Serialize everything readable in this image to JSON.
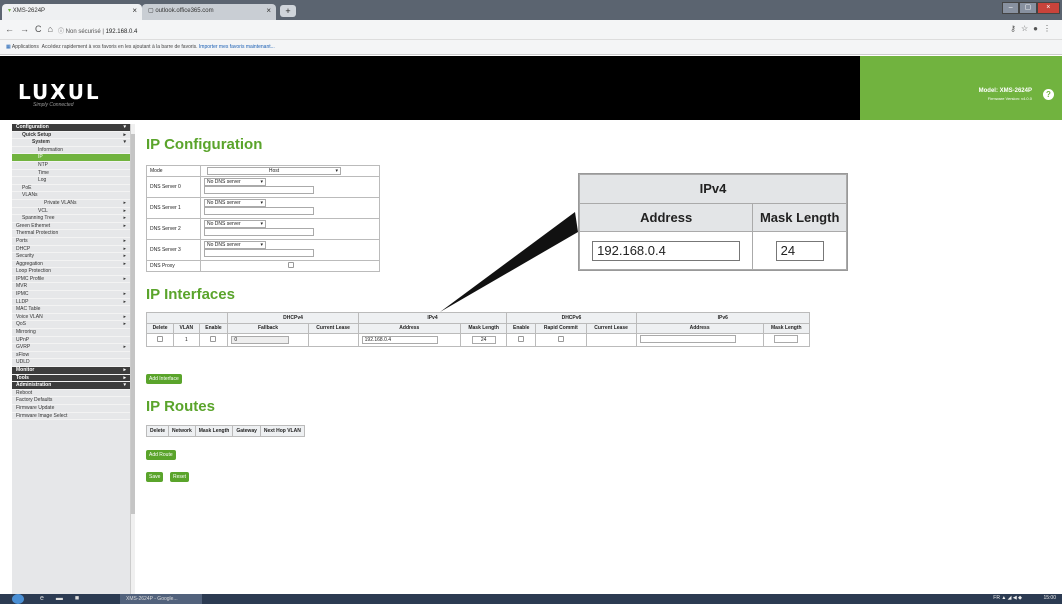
{
  "browser": {
    "tabs": [
      {
        "title": "XMS-2624P",
        "active": true
      },
      {
        "title": "outlook.office365.com",
        "active": false
      }
    ],
    "address": {
      "prefix": "Non sécurisé",
      "url": "192.168.0.4"
    },
    "bookmarks": {
      "apps": "Applications",
      "text": "Accédez rapidement à vos favoris en les ajoutant à la barre de favoris.",
      "link": "Importer mes favoris maintenant..."
    }
  },
  "header": {
    "logo": "LUXUL",
    "tagline": "Simply Connected",
    "model": "Model: XMS-2624P",
    "firmware": "Firmware Version: v4.0.0",
    "help": "?"
  },
  "sidebar": {
    "items": [
      {
        "label": "Configuration",
        "kind": "sec",
        "arrow": "▾"
      },
      {
        "label": "Quick Setup",
        "kind": "l1",
        "arrow": "▸"
      },
      {
        "label": "System",
        "kind": "l2",
        "arrow": "▾"
      },
      {
        "label": "Information",
        "kind": "l3"
      },
      {
        "label": "IP",
        "kind": "l3 active"
      },
      {
        "label": "NTP",
        "kind": "l3"
      },
      {
        "label": "Time",
        "kind": "l3"
      },
      {
        "label": "Log",
        "kind": "l3"
      },
      {
        "label": "PoE",
        "kind": "l1x"
      },
      {
        "label": "VLANs",
        "kind": "l1x"
      },
      {
        "label": "Private VLANs",
        "kind": "l4",
        "arrow": "▸"
      },
      {
        "label": "VCL",
        "kind": "l3",
        "arrow": "▸"
      },
      {
        "label": "Spanning Tree",
        "kind": "l1x",
        "arrow": "▸"
      },
      {
        "label": "Green Ethernet",
        "kind": "n",
        "arrow": "▸"
      },
      {
        "label": "Thermal Protection",
        "kind": "n"
      },
      {
        "label": "Ports",
        "kind": "n",
        "arrow": "▸"
      },
      {
        "label": "DHCP",
        "kind": "n",
        "arrow": "▸"
      },
      {
        "label": "Security",
        "kind": "n",
        "arrow": "▸"
      },
      {
        "label": "Aggregation",
        "kind": "n",
        "arrow": "▸"
      },
      {
        "label": "Loop Protection",
        "kind": "n"
      },
      {
        "label": "IPMC Profile",
        "kind": "n",
        "arrow": "▸"
      },
      {
        "label": "MVR",
        "kind": "n"
      },
      {
        "label": "IPMC",
        "kind": "n",
        "arrow": "▸"
      },
      {
        "label": "LLDP",
        "kind": "n",
        "arrow": "▸"
      },
      {
        "label": "MAC Table",
        "kind": "n"
      },
      {
        "label": "Voice VLAN",
        "kind": "n",
        "arrow": "▸"
      },
      {
        "label": "QoS",
        "kind": "n",
        "arrow": "▸"
      },
      {
        "label": "Mirroring",
        "kind": "n"
      },
      {
        "label": "UPnP",
        "kind": "n"
      },
      {
        "label": "GVRP",
        "kind": "n",
        "arrow": "▸"
      },
      {
        "label": "sFlow",
        "kind": "n"
      },
      {
        "label": "UDLD",
        "kind": "n"
      },
      {
        "label": "Monitor",
        "kind": "sec",
        "arrow": "▸"
      },
      {
        "label": "Tools",
        "kind": "sec",
        "arrow": "▸"
      },
      {
        "label": "Administration",
        "kind": "sec",
        "arrow": "▾"
      },
      {
        "label": "Reboot",
        "kind": "n"
      },
      {
        "label": "Factory Defaults",
        "kind": "n"
      },
      {
        "label": "Firmware Update",
        "kind": "n"
      },
      {
        "label": "Firmware Image Select",
        "kind": "n"
      }
    ]
  },
  "ip_config": {
    "title": "IP Configuration",
    "rows": [
      {
        "label": "Mode",
        "value": "Host",
        "type": "mode"
      },
      {
        "label": "DNS Server 0",
        "value": "No DNS server",
        "type": "dns"
      },
      {
        "label": "DNS Server 1",
        "value": "No DNS server",
        "type": "dns"
      },
      {
        "label": "DNS Server 2",
        "value": "No DNS server",
        "type": "dns"
      },
      {
        "label": "DNS Server 3",
        "value": "No DNS server",
        "type": "dns"
      },
      {
        "label": "DNS Proxy",
        "value": "",
        "type": "check"
      }
    ]
  },
  "ip_interfaces": {
    "title": "IP Interfaces",
    "groups": {
      "dhcpv4": "DHCPv4",
      "ipv4": "IPv4",
      "dhcpv6": "DHCPv6",
      "ipv6": "IPv6"
    },
    "headers": [
      "Delete",
      "VLAN",
      "Enable",
      "Fallback",
      "Current Lease",
      "Address",
      "Mask Length",
      "Enable",
      "Rapid Commit",
      "Current Lease",
      "Address",
      "Mask Length"
    ],
    "row": {
      "vlan": "1",
      "fallback": "0",
      "ipv4_address": "192.168.0.4",
      "ipv4_mask": "24",
      "ipv6_address": "",
      "ipv6_mask": ""
    },
    "add_button": "Add Interface"
  },
  "ip_routes": {
    "title": "IP Routes",
    "headers": [
      "Delete",
      "Network",
      "Mask Length",
      "Gateway",
      "Next Hop VLAN"
    ],
    "add_button": "Add Route",
    "save_button": "Save",
    "reset_button": "Reset"
  },
  "zoom": {
    "group": "IPv4",
    "address_header": "Address",
    "mask_header": "Mask Length",
    "address": "192.168.0.4",
    "mask": "24"
  },
  "taskbar": {
    "window": "XMS-2624P - Google...",
    "clock": "15:00",
    "tray": "FR ▲ ◢ ◀ ◆"
  },
  "colors": {
    "accent": "#71b33f",
    "title_green": "#5aa42b",
    "header_bg": "#000000"
  }
}
